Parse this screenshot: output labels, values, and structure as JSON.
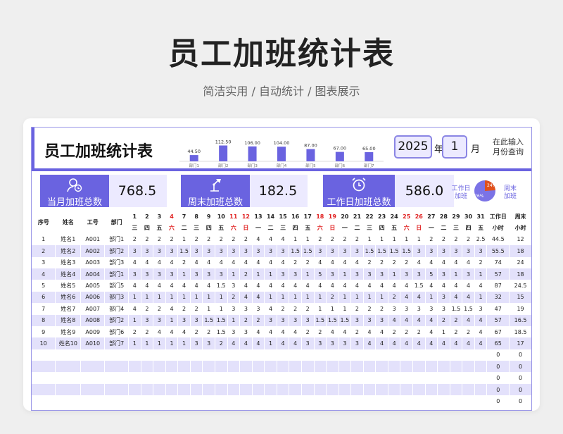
{
  "page": {
    "title": "员工加班统计表",
    "subtitle": "简洁实用 / 自动统计 / 图表展示"
  },
  "sheet": {
    "title": "员工加班统计表",
    "year": "2025",
    "year_label": "年",
    "month": "1",
    "month_label": "月",
    "query_line1": "在此输入",
    "query_line2": "月份查询"
  },
  "kpis": [
    {
      "label": "当月加班总数",
      "value": "768.5",
      "icon": "person-clock-icon"
    },
    {
      "label": "周末加班总数",
      "value": "182.5",
      "icon": "desk-lamp-icon"
    },
    {
      "label": "工作日加班总数",
      "value": "586.0",
      "icon": "alarm-clock-icon"
    }
  ],
  "pie": {
    "workday_label": "工作日加班",
    "weekend_label": "周末加班",
    "weekend_pct": "24%",
    "workday_pct": "76%",
    "colors": {
      "workday": "#7b73e6",
      "weekend": "#e0501c"
    }
  },
  "chart_data": {
    "type": "bar",
    "categories": [
      "部门1",
      "部门2",
      "部门3",
      "部门4",
      "部门5",
      "部门6",
      "部门7"
    ],
    "values": [
      44.5,
      112.5,
      106.0,
      104.0,
      87.0,
      67.0,
      65.0
    ],
    "labels": [
      "44.50",
      "112.50",
      "106.00",
      "104.00",
      "87.00",
      "67.00",
      "65.00"
    ],
    "color": "#6a63e0"
  },
  "table": {
    "headers": {
      "no": "序号",
      "name": "姓名",
      "id": "工号",
      "dept": "部门",
      "work": "工作日",
      "work2": "小时",
      "week": "周末",
      "week2": "小时"
    },
    "days": [
      "1",
      "2",
      "3",
      "4",
      "7",
      "8",
      "9",
      "10",
      "11",
      "12",
      "13",
      "14",
      "15",
      "16",
      "17",
      "18",
      "19",
      "20",
      "21",
      "22",
      "23",
      "24",
      "25",
      "26",
      "27",
      "28",
      "29",
      "30",
      "31"
    ],
    "weekdays": [
      "三",
      "四",
      "五",
      "六",
      "二",
      "三",
      "四",
      "五",
      "六",
      "日",
      "一",
      "二",
      "三",
      "四",
      "五",
      "六",
      "日",
      "一",
      "二",
      "三",
      "四",
      "五",
      "六",
      "日",
      "一",
      "二",
      "三",
      "四",
      "五"
    ],
    "red_cols": [
      3,
      8,
      9,
      15,
      16,
      22,
      23
    ],
    "rows": [
      {
        "no": "1",
        "name": "姓名1",
        "id": "A001",
        "dept": "部门1",
        "vals": [
          "2",
          "2",
          "2",
          "2",
          "1",
          "2",
          "2",
          "2",
          "2",
          "2",
          "4",
          "4",
          "4",
          "1",
          "1",
          "2",
          "2",
          "2",
          "2",
          "1",
          "1",
          "1",
          "1",
          "1",
          "2",
          "2",
          "2",
          "2",
          "2.5"
        ],
        "work": "44.5",
        "week": "12"
      },
      {
        "no": "2",
        "name": "姓名2",
        "id": "A002",
        "dept": "部门2",
        "vals": [
          "3",
          "3",
          "3",
          "3",
          "1.5",
          "3",
          "3",
          "3",
          "3",
          "3",
          "3",
          "3",
          "3",
          "1.5",
          "1.5",
          "3",
          "3",
          "3",
          "3",
          "1.5",
          "1.5",
          "1.5",
          "1.5",
          "3",
          "3",
          "3",
          "3",
          "3",
          "3"
        ],
        "work": "55.5",
        "week": "18"
      },
      {
        "no": "3",
        "name": "姓名3",
        "id": "A003",
        "dept": "部门3",
        "vals": [
          "4",
          "4",
          "4",
          "4",
          "2",
          "4",
          "4",
          "4",
          "4",
          "4",
          "4",
          "4",
          "4",
          "2",
          "2",
          "4",
          "4",
          "4",
          "4",
          "2",
          "2",
          "2",
          "2",
          "4",
          "4",
          "4",
          "4",
          "4",
          "2"
        ],
        "work": "74",
        "week": "24"
      },
      {
        "no": "4",
        "name": "姓名4",
        "id": "A004",
        "dept": "部门1",
        "vals": [
          "3",
          "3",
          "3",
          "3",
          "1",
          "3",
          "3",
          "3",
          "1",
          "2",
          "1",
          "1",
          "3",
          "3",
          "1",
          "5",
          "3",
          "1",
          "3",
          "3",
          "3",
          "1",
          "3",
          "3",
          "5",
          "3",
          "1",
          "3",
          "1"
        ],
        "work": "57",
        "week": "18"
      },
      {
        "no": "5",
        "name": "姓名5",
        "id": "A005",
        "dept": "部门5",
        "vals": [
          "4",
          "4",
          "4",
          "4",
          "4",
          "4",
          "4",
          "1.5",
          "3",
          "4",
          "4",
          "4",
          "4",
          "4",
          "4",
          "4",
          "4",
          "4",
          "4",
          "4",
          "4",
          "4",
          "4",
          "1.5",
          "4",
          "4",
          "4",
          "4",
          "4"
        ],
        "work": "87",
        "week": "24.5"
      },
      {
        "no": "6",
        "name": "姓名6",
        "id": "A006",
        "dept": "部门3",
        "vals": [
          "1",
          "1",
          "1",
          "1",
          "1",
          "1",
          "1",
          "1",
          "2",
          "4",
          "4",
          "1",
          "1",
          "1",
          "1",
          "1",
          "2",
          "1",
          "1",
          "1",
          "1",
          "2",
          "4",
          "4",
          "1",
          "3",
          "4",
          "4",
          "1"
        ],
        "work": "32",
        "week": "15"
      },
      {
        "no": "7",
        "name": "姓名7",
        "id": "A007",
        "dept": "部门4",
        "vals": [
          "4",
          "2",
          "2",
          "4",
          "2",
          "2",
          "1",
          "1",
          "3",
          "3",
          "3",
          "4",
          "2",
          "2",
          "2",
          "1",
          "1",
          "1",
          "2",
          "2",
          "2",
          "3",
          "3",
          "3",
          "3",
          "3",
          "1.5",
          "1.5",
          "3"
        ],
        "work": "47",
        "week": "19"
      },
      {
        "no": "8",
        "name": "姓名8",
        "id": "A008",
        "dept": "部门2",
        "vals": [
          "1",
          "3",
          "3",
          "1",
          "3",
          "3",
          "1.5",
          "1.5",
          "1",
          "2",
          "2",
          "3",
          "3",
          "3",
          "3",
          "1.5",
          "1.5",
          "1.5",
          "3",
          "3",
          "3",
          "4",
          "4",
          "4",
          "4",
          "2",
          "2",
          "4",
          "4"
        ],
        "work": "57",
        "week": "16.5"
      },
      {
        "no": "9",
        "name": "姓名9",
        "id": "A009",
        "dept": "部门6",
        "vals": [
          "2",
          "2",
          "4",
          "4",
          "4",
          "2",
          "2",
          "1.5",
          "3",
          "3",
          "4",
          "4",
          "4",
          "4",
          "2",
          "2",
          "4",
          "4",
          "2",
          "4",
          "4",
          "2",
          "2",
          "2",
          "4",
          "1",
          "2",
          "2",
          "4"
        ],
        "work": "67",
        "week": "18.5"
      },
      {
        "no": "10",
        "name": "姓名10",
        "id": "A010",
        "dept": "部门7",
        "vals": [
          "1",
          "1",
          "1",
          "1",
          "1",
          "3",
          "3",
          "2",
          "4",
          "4",
          "4",
          "1",
          "4",
          "4",
          "3",
          "3",
          "3",
          "3",
          "3",
          "4",
          "4",
          "4",
          "4",
          "4",
          "4",
          "4",
          "4",
          "4",
          "4"
        ],
        "work": "65",
        "week": "17"
      },
      {
        "no": "",
        "name": "",
        "id": "",
        "dept": "",
        "vals": [],
        "work": "0",
        "week": "0"
      },
      {
        "no": "",
        "name": "",
        "id": "",
        "dept": "",
        "vals": [],
        "work": "0",
        "week": "0"
      },
      {
        "no": "",
        "name": "",
        "id": "",
        "dept": "",
        "vals": [],
        "work": "0",
        "week": "0"
      },
      {
        "no": "",
        "name": "",
        "id": "",
        "dept": "",
        "vals": [],
        "work": "0",
        "week": "0"
      },
      {
        "no": "",
        "name": "",
        "id": "",
        "dept": "",
        "vals": [],
        "work": "0",
        "week": "0"
      }
    ]
  }
}
